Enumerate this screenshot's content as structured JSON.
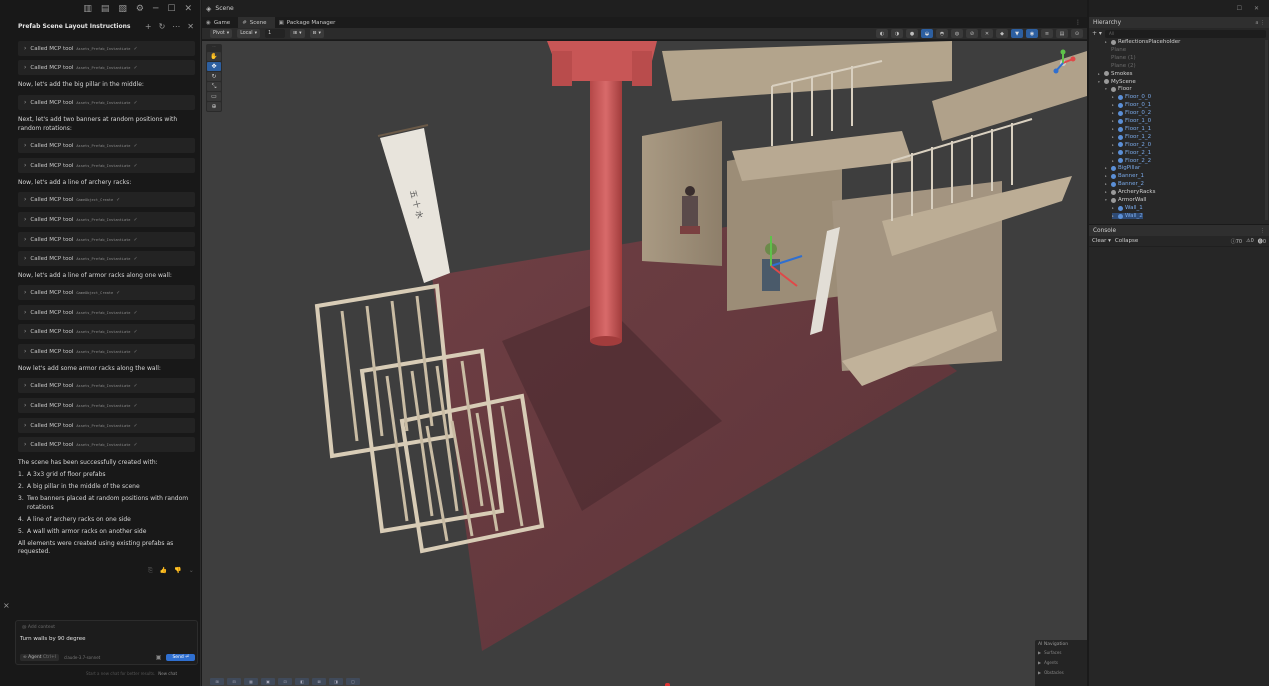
{
  "chat": {
    "top_icons": [
      "▥",
      "▤",
      "▧",
      "⚙",
      "─",
      "☐",
      "✕"
    ],
    "title": "Prefab Scene Layout Instructions",
    "title_icons": [
      "+",
      "↻",
      "⋯",
      "✕"
    ],
    "tool_label": "Called MCP tool",
    "check": "✓",
    "chevron": "›",
    "tool_rows": [
      {
        "code": "Assets_Prefab_Instantiate"
      },
      {
        "code": "Assets_Prefab_Instantiate"
      },
      {
        "code": "Assets_Prefab_Instantiate"
      },
      {
        "code": "Assets_Prefab_Instantiate"
      },
      {
        "code": "Assets_Prefab_Instantiate"
      },
      {
        "code": "GameObject_Create"
      },
      {
        "code": "Assets_Prefab_Instantiate"
      },
      {
        "code": "Assets_Prefab_Instantiate"
      },
      {
        "code": "Assets_Prefab_Instantiate"
      },
      {
        "code": "GameObject_Create"
      },
      {
        "code": "Assets_Prefab_Instantiate"
      },
      {
        "code": "Assets_Prefab_Instantiate"
      },
      {
        "code": "Assets_Prefab_Instantiate"
      },
      {
        "code": "Assets_Prefab_Instantiate"
      },
      {
        "code": "Assets_Prefab_Instantiate"
      },
      {
        "code": "Assets_Prefab_Instantiate"
      },
      {
        "code": "Assets_Prefab_Instantiate"
      }
    ],
    "messages": [
      "Now, let's add the big pillar in the middle:",
      "Next, let's add two banners at random positions with random rotations:",
      "Now, let's add a line of archery racks:",
      "Now, let's add a line of armor racks along one wall:",
      "Now let's add some armor racks along the wall:"
    ],
    "summary_intro": "The scene has been successfully created with:",
    "summary_items": [
      {
        "n": "1.",
        "text": "A 3x3 grid of floor prefabs"
      },
      {
        "n": "2.",
        "text": "A big pillar in the middle of the scene"
      },
      {
        "n": "3.",
        "text": "Two banners placed at random positions with random rotations"
      },
      {
        "n": "4.",
        "text": "A line of archery racks on one side"
      },
      {
        "n": "5.",
        "text": "A wall with armor racks on another side"
      }
    ],
    "summary_outro": "All elements were created using existing prefabs as requested.",
    "reactions": [
      "⎘",
      "👍",
      "👎",
      "⌄"
    ],
    "panel_close": "×",
    "add_context": "@ Add context",
    "input_value": "Turn walls by 90 degree",
    "agent_mode": "∞ Agent",
    "agent_shortcut": "Ctrl+I",
    "model": "claude-3.7-sonnet",
    "image_icon": "▣",
    "send_label": "Send ⏎",
    "footer_hint": "Start a new chat for better results.",
    "footer_new_chat": "New chat"
  },
  "scene": {
    "window_title": "Scene",
    "tabs": [
      {
        "icon": "◉",
        "label": "Game"
      },
      {
        "icon": "#",
        "label": "Scene"
      },
      {
        "icon": "▣",
        "label": "Package Manager"
      }
    ],
    "tabs_more": "⋮",
    "pivot": "Pivot",
    "local": "Local",
    "grid_value": "1",
    "grid_icon": "⊞",
    "snap_icon": "⊟",
    "tool_palette_header": "···",
    "tool_icons": [
      "✋",
      "✥",
      "↻",
      "⤡",
      "▭",
      "⊕"
    ],
    "toolbar_right_icons": [
      "◐",
      "◑",
      "●",
      "◒",
      "◓",
      "◍",
      "⊘",
      "✕",
      "◆",
      "▼",
      "◉",
      "≡",
      "▤",
      "⊙"
    ],
    "bottom_icons": [
      "⊞",
      "⊟",
      "▦",
      "▣",
      "⊡",
      "◧",
      "⊠",
      "◨",
      "▢"
    ],
    "gizmo_label": "",
    "ai_navigation": {
      "title": "AI Navigation",
      "items": [
        "Surfaces",
        "Agents",
        "Obstacles"
      ]
    },
    "banner_text": "五 十 水"
  },
  "hierarchy": {
    "window_controls": [
      "☐",
      "✕"
    ],
    "title": "Hierarchy",
    "menu": "a ⋮",
    "add_icon": "+ ▾",
    "search_placeholder": "All",
    "items": [
      {
        "indent": 2,
        "arrow": "▸",
        "label": "ReflectionsPlaceholder",
        "style": "white",
        "icon": "#9a9a9a"
      },
      {
        "indent": 2,
        "arrow": "",
        "label": "Plane",
        "style": "dim",
        "icon": ""
      },
      {
        "indent": 2,
        "arrow": "",
        "label": "Plane (1)",
        "style": "dim",
        "icon": ""
      },
      {
        "indent": 2,
        "arrow": "",
        "label": "Plane (2)",
        "style": "dim",
        "icon": ""
      },
      {
        "indent": 1,
        "arrow": "▸",
        "label": "Smokes",
        "style": "white",
        "icon": "#9a9a9a"
      },
      {
        "indent": 1,
        "arrow": "▾",
        "label": "MyScene",
        "style": "white",
        "icon": "#9a9a9a"
      },
      {
        "indent": 2,
        "arrow": "▾",
        "label": "Floor",
        "style": "white",
        "icon": "#9a9a9a"
      },
      {
        "indent": 3,
        "arrow": "▸",
        "label": "Floor_0_0",
        "style": "blue",
        "icon": "#5b8fd6"
      },
      {
        "indent": 3,
        "arrow": "▸",
        "label": "Floor_0_1",
        "style": "blue",
        "icon": "#5b8fd6"
      },
      {
        "indent": 3,
        "arrow": "▸",
        "label": "Floor_0_2",
        "style": "blue",
        "icon": "#5b8fd6"
      },
      {
        "indent": 3,
        "arrow": "▸",
        "label": "Floor_1_0",
        "style": "blue",
        "icon": "#5b8fd6"
      },
      {
        "indent": 3,
        "arrow": "▸",
        "label": "Floor_1_1",
        "style": "blue",
        "icon": "#5b8fd6"
      },
      {
        "indent": 3,
        "arrow": "▸",
        "label": "Floor_1_2",
        "style": "blue",
        "icon": "#5b8fd6"
      },
      {
        "indent": 3,
        "arrow": "▸",
        "label": "Floor_2_0",
        "style": "blue",
        "icon": "#5b8fd6"
      },
      {
        "indent": 3,
        "arrow": "▸",
        "label": "Floor_2_1",
        "style": "blue",
        "icon": "#5b8fd6"
      },
      {
        "indent": 3,
        "arrow": "▸",
        "label": "Floor_2_2",
        "style": "blue",
        "icon": "#5b8fd6"
      },
      {
        "indent": 2,
        "arrow": "▸",
        "label": "BigPillar",
        "style": "blue",
        "icon": "#5b8fd6"
      },
      {
        "indent": 2,
        "arrow": "▸",
        "label": "Banner_1",
        "style": "blue",
        "icon": "#5b8fd6"
      },
      {
        "indent": 2,
        "arrow": "▸",
        "label": "Banner_2",
        "style": "blue",
        "icon": "#5b8fd6"
      },
      {
        "indent": 2,
        "arrow": "▸",
        "label": "ArcheryRacks",
        "style": "white",
        "icon": "#9a9a9a"
      },
      {
        "indent": 2,
        "arrow": "▾",
        "label": "ArmorWall",
        "style": "white",
        "icon": "#9a9a9a"
      },
      {
        "indent": 3,
        "arrow": "▸",
        "label": "Wall_1",
        "style": "blue",
        "icon": "#5b8fd6"
      },
      {
        "indent": 3,
        "arrow": "▸",
        "label": "Wall_2",
        "style": "blue",
        "icon": "#5b8fd6"
      }
    ]
  },
  "console": {
    "title": "Console",
    "menu": "⋮",
    "clear": "Clear",
    "clear_arrow": "▾",
    "collapse": "Collapse",
    "counts": {
      "info": "70",
      "warn": "0",
      "error": "0"
    },
    "count_icons": {
      "info": "ⓘ",
      "warn": "⚠",
      "error": "⓿"
    }
  }
}
